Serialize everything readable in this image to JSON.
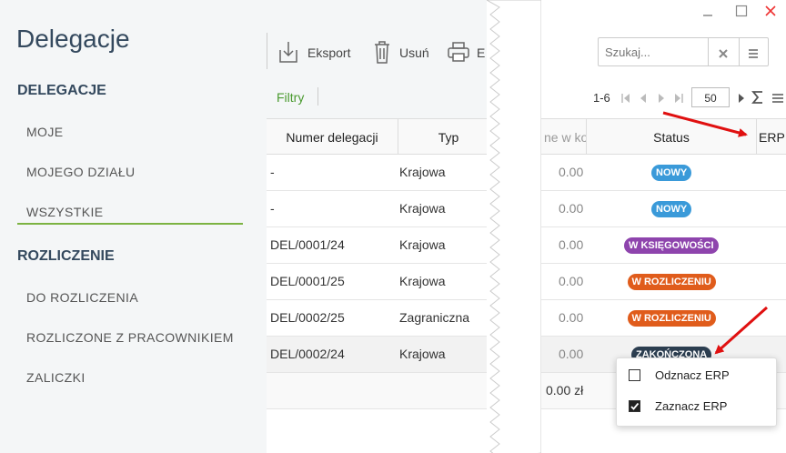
{
  "app_title": "Delegacje",
  "sidebar": {
    "section1": "DELEGACJE",
    "items1": [
      "MOJE",
      "MOJEGO DZIAŁU",
      "WSZYSTKIE"
    ],
    "section2": "ROZLICZENIE",
    "items2": [
      "DO ROZLICZENIA",
      "ROZLICZONE Z PRACOWNIKIEM",
      "ZALICZKI"
    ]
  },
  "toolbar": {
    "export": "Eksport",
    "delete": "Usuń",
    "print_partial": "E"
  },
  "filters_label": "Filtry",
  "search": {
    "placeholder": "Szukaj..."
  },
  "pager": {
    "range": "1-6",
    "page_size": "50"
  },
  "columns": {
    "number": "Numer delegacji",
    "type": "Typ",
    "partial": "ne w ko",
    "status": "Status",
    "erp": "ERP"
  },
  "rows": [
    {
      "number": "-",
      "type": "Krajowa",
      "amount": "0.00",
      "status": "NOWY"
    },
    {
      "number": "-",
      "type": "Krajowa",
      "amount": "0.00",
      "status": "NOWY"
    },
    {
      "number": "DEL/0001/24",
      "type": "Krajowa",
      "amount": "0.00",
      "status": "W KSIĘGOWOŚCI"
    },
    {
      "number": "DEL/0001/25",
      "type": "Krajowa",
      "amount": "0.00",
      "status": "W ROZLICZENIU"
    },
    {
      "number": "DEL/0002/25",
      "type": "Zagraniczna",
      "amount": "0.00",
      "status": "W ROZLICZENIU"
    },
    {
      "number": "DEL/0002/24",
      "type": "Krajowa",
      "amount": "0.00",
      "status": "ZAKOŃCZONA"
    }
  ],
  "footer_total": "0.00 zł",
  "context_menu": {
    "uncheck": "Odznacz ERP",
    "check": "Zaznacz ERP"
  },
  "colors": {
    "accent_green": "#7cb342",
    "badge_new": "#3a9ad9",
    "badge_accounting": "#8e44ad",
    "badge_settlement": "#e05c1b",
    "badge_done": "#2c3e50",
    "arrow": "#e01010"
  }
}
